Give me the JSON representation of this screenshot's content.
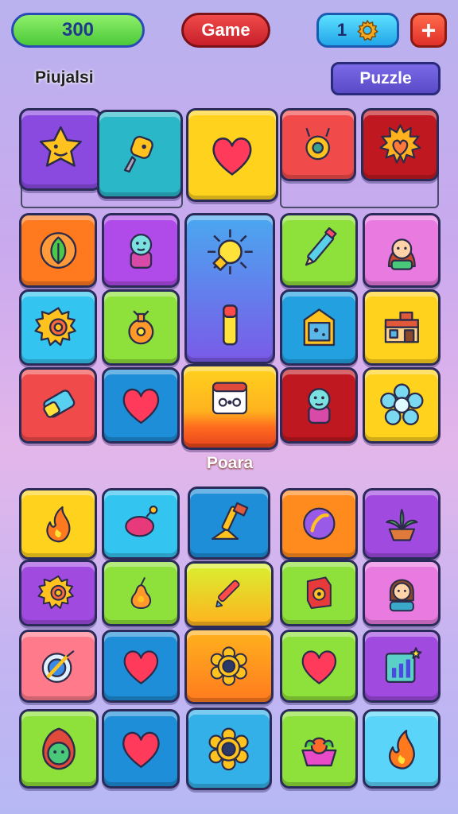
{
  "header": {
    "score": "300",
    "game_label": "Game",
    "level": "1",
    "level_icon": "gear-icon",
    "plus_label": "+"
  },
  "board_top": {
    "label": "Piujalsi",
    "puzzle_button": "Puzzle"
  },
  "featured_tile": {
    "label": "Poara",
    "icon": "robot-face-icon"
  },
  "colors": {
    "score_pill": "#5fd84a",
    "game_pill": "#e0303a",
    "level_pill": "#3cc4f4",
    "plus_button": "#ee4a32",
    "puzzle_button": "#6a5ad8"
  },
  "tiles": [
    {
      "icon": "star-face-icon",
      "color": "#8a4ae0"
    },
    {
      "icon": "key-icon",
      "color": "#2ab8c8"
    },
    {
      "icon": "heart-icon",
      "color": "#ffd21e"
    },
    {
      "icon": "ring-icon",
      "color": "#f04a4a"
    },
    {
      "icon": "sun-heart-icon",
      "color": "#c01820"
    },
    {
      "icon": "leaf-icon",
      "color": "#ff7a1e"
    },
    {
      "icon": "character-icon",
      "color": "#b04ae8"
    },
    {
      "icon": "sun-icon",
      "color": "#4aa8f0"
    },
    {
      "icon": "pencil-icon",
      "color": "#8ee03a"
    },
    {
      "icon": "girl-avatar-icon",
      "color": "#e87ae0"
    },
    {
      "icon": "spiral-sun-icon",
      "color": "#34c4f0"
    },
    {
      "icon": "potion-icon",
      "color": "#8ee03a"
    },
    {
      "icon": "battery-icon",
      "color": "#7a5ae8"
    },
    {
      "icon": "frame-icon",
      "color": "#22a0e0"
    },
    {
      "icon": "shop-icon",
      "color": "#ffd21e"
    },
    {
      "icon": "eraser-icon",
      "color": "#f04a4a"
    },
    {
      "icon": "heart-icon",
      "color": "#1e8ed8"
    },
    {
      "icon": "character-icon",
      "color": "#c01820"
    },
    {
      "icon": "flower-icon",
      "color": "#ffd21e"
    },
    {
      "icon": "fire-icon",
      "color": "#ffd21e"
    },
    {
      "icon": "lips-icon",
      "color": "#34c4f0"
    },
    {
      "icon": "shovel-icon",
      "color": "#1e8ed8"
    },
    {
      "icon": "ball-icon",
      "color": "#ff8a1e"
    },
    {
      "icon": "plant-icon",
      "color": "#a04ae0"
    },
    {
      "icon": "spiral-sun-icon",
      "color": "#a04ae0"
    },
    {
      "icon": "pear-icon",
      "color": "#8ee03a"
    },
    {
      "icon": "pen-icon",
      "color": "#d8f030"
    },
    {
      "icon": "safe-icon",
      "color": "#8ee03a"
    },
    {
      "icon": "boy-avatar-icon",
      "color": "#e87ae0"
    },
    {
      "icon": "compass-icon",
      "color": "#ff7a8a"
    },
    {
      "icon": "heart-icon",
      "color": "#1e8ed8"
    },
    {
      "icon": "donut-icon",
      "color": "#ff8a1e"
    },
    {
      "icon": "heart-icon",
      "color": "#8ee03a"
    },
    {
      "icon": "chart-icon",
      "color": "#a04ae0"
    },
    {
      "icon": "egg-face-icon",
      "color": "#8ee03a"
    },
    {
      "icon": "heart-icon",
      "color": "#1e8ed8"
    },
    {
      "icon": "donut-icon",
      "color": "#34b0e8"
    },
    {
      "icon": "fruit-bowl-icon",
      "color": "#8ee03a"
    },
    {
      "icon": "fire-icon",
      "color": "#5ad4f8"
    }
  ]
}
